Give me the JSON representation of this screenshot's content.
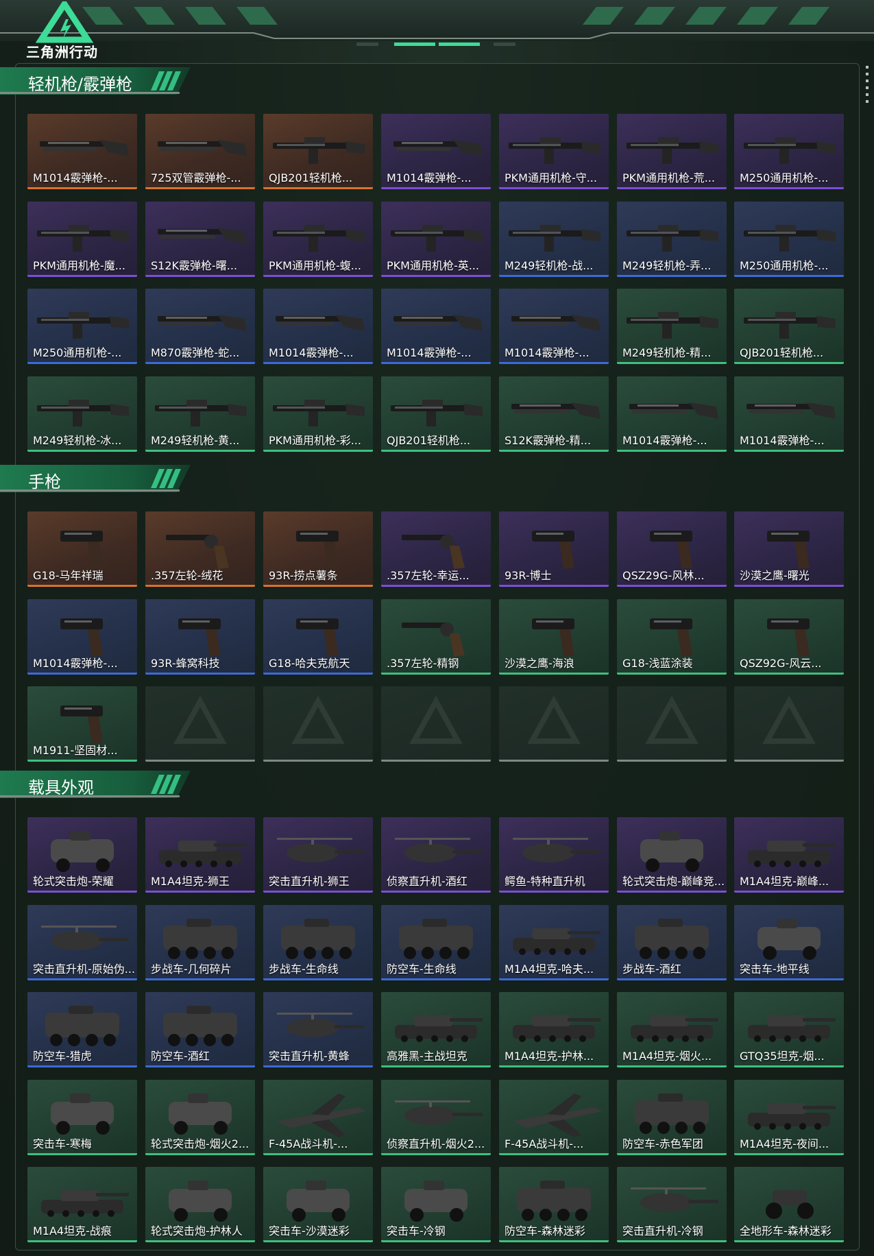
{
  "app": {
    "logo_text": "三角洲行动",
    "accent_color": "#3ddc97"
  },
  "rarity_colors": {
    "orange": "#d9732b",
    "purple": "#7b4fd6",
    "blue": "#3d6ad8",
    "green": "#3fc07e",
    "empty": "#7d8a83"
  },
  "sections": [
    {
      "title": "轻机枪/霰弹枪",
      "items": [
        {
          "label": "M1014霰弹枪-...",
          "rarity": "orange",
          "icon": "shotgun-icon"
        },
        {
          "label": "725双管霰弹枪-...",
          "rarity": "orange",
          "icon": "shotgun-icon"
        },
        {
          "label": "QJB201轻机枪...",
          "rarity": "orange",
          "icon": "machine-gun-icon"
        },
        {
          "label": "M1014霰弹枪-...",
          "rarity": "purple",
          "icon": "shotgun-icon"
        },
        {
          "label": "PKM通用机枪-守...",
          "rarity": "purple",
          "icon": "machine-gun-icon"
        },
        {
          "label": "PKM通用机枪-荒...",
          "rarity": "purple",
          "icon": "machine-gun-icon"
        },
        {
          "label": "M250通用机枪-...",
          "rarity": "purple",
          "icon": "machine-gun-icon"
        },
        {
          "label": "PKM通用机枪-魔...",
          "rarity": "purple",
          "icon": "machine-gun-icon"
        },
        {
          "label": "S12K霰弹枪-曙...",
          "rarity": "purple",
          "icon": "shotgun-icon"
        },
        {
          "label": "PKM通用机枪-蝮...",
          "rarity": "purple",
          "icon": "machine-gun-icon"
        },
        {
          "label": "PKM通用机枪-英...",
          "rarity": "purple",
          "icon": "machine-gun-icon"
        },
        {
          "label": "M249轻机枪-战...",
          "rarity": "blue",
          "icon": "machine-gun-icon"
        },
        {
          "label": "M249轻机枪-弄...",
          "rarity": "blue",
          "icon": "machine-gun-icon"
        },
        {
          "label": "M250通用机枪-...",
          "rarity": "blue",
          "icon": "machine-gun-icon"
        },
        {
          "label": "M250通用机枪-...",
          "rarity": "blue",
          "icon": "machine-gun-icon"
        },
        {
          "label": "M870霰弹枪-蛇...",
          "rarity": "blue",
          "icon": "shotgun-icon"
        },
        {
          "label": "M1014霰弹枪-...",
          "rarity": "blue",
          "icon": "shotgun-icon"
        },
        {
          "label": "M1014霰弹枪-...",
          "rarity": "blue",
          "icon": "shotgun-icon"
        },
        {
          "label": "M1014霰弹枪-...",
          "rarity": "blue",
          "icon": "shotgun-icon"
        },
        {
          "label": "M249轻机枪-精...",
          "rarity": "green",
          "icon": "machine-gun-icon"
        },
        {
          "label": "QJB201轻机枪...",
          "rarity": "green",
          "icon": "machine-gun-icon"
        },
        {
          "label": "M249轻机枪-冰...",
          "rarity": "green",
          "icon": "machine-gun-icon"
        },
        {
          "label": "M249轻机枪-黄...",
          "rarity": "green",
          "icon": "machine-gun-icon"
        },
        {
          "label": "PKM通用机枪-彩...",
          "rarity": "green",
          "icon": "machine-gun-icon"
        },
        {
          "label": "QJB201轻机枪...",
          "rarity": "green",
          "icon": "machine-gun-icon"
        },
        {
          "label": "S12K霰弹枪-精...",
          "rarity": "green",
          "icon": "shotgun-icon"
        },
        {
          "label": "M1014霰弹枪-...",
          "rarity": "green",
          "icon": "shotgun-icon"
        },
        {
          "label": "M1014霰弹枪-...",
          "rarity": "green",
          "icon": "shotgun-icon"
        }
      ]
    },
    {
      "title": "手枪",
      "items": [
        {
          "label": "G18-马年祥瑞",
          "rarity": "orange",
          "icon": "pistol-icon"
        },
        {
          "label": ".357左轮-绒花",
          "rarity": "orange",
          "icon": "revolver-icon"
        },
        {
          "label": "93R-捞点薯条",
          "rarity": "orange",
          "icon": "pistol-icon"
        },
        {
          "label": ".357左轮-幸运...",
          "rarity": "purple",
          "icon": "revolver-icon"
        },
        {
          "label": "93R-博士",
          "rarity": "purple",
          "icon": "pistol-icon"
        },
        {
          "label": "QSZ29G-风林...",
          "rarity": "purple",
          "icon": "pistol-icon"
        },
        {
          "label": "沙漠之鹰-曙光",
          "rarity": "purple",
          "icon": "pistol-icon"
        },
        {
          "label": "M1014霰弹枪-...",
          "rarity": "blue",
          "icon": "pistol-icon"
        },
        {
          "label": "93R-蜂窝科技",
          "rarity": "blue",
          "icon": "pistol-icon"
        },
        {
          "label": "G18-哈夫克航天",
          "rarity": "blue",
          "icon": "pistol-icon"
        },
        {
          "label": ".357左轮-精钢",
          "rarity": "green",
          "icon": "revolver-icon"
        },
        {
          "label": "沙漠之鹰-海浪",
          "rarity": "green",
          "icon": "pistol-icon"
        },
        {
          "label": "G18-浅蓝涂装",
          "rarity": "green",
          "icon": "pistol-icon"
        },
        {
          "label": "QSZ92G-风云...",
          "rarity": "green",
          "icon": "pistol-icon"
        },
        {
          "label": "M1911-坚固材...",
          "rarity": "green",
          "icon": "pistol-icon"
        },
        {
          "label": "",
          "rarity": "empty",
          "icon": "placeholder-logo-icon"
        },
        {
          "label": "",
          "rarity": "empty",
          "icon": "placeholder-logo-icon"
        },
        {
          "label": "",
          "rarity": "empty",
          "icon": "placeholder-logo-icon"
        },
        {
          "label": "",
          "rarity": "empty",
          "icon": "placeholder-logo-icon"
        },
        {
          "label": "",
          "rarity": "empty",
          "icon": "placeholder-logo-icon"
        },
        {
          "label": "",
          "rarity": "empty",
          "icon": "placeholder-logo-icon"
        }
      ]
    },
    {
      "title": "载具外观",
      "items": [
        {
          "label": "轮式突击炮-荣耀",
          "rarity": "purple",
          "icon": "armored-car-icon"
        },
        {
          "label": "M1A4坦克-狮王",
          "rarity": "purple",
          "icon": "tank-icon"
        },
        {
          "label": "突击直升机-狮王",
          "rarity": "purple",
          "icon": "helicopter-icon"
        },
        {
          "label": "侦察直升机-酒红",
          "rarity": "purple",
          "icon": "helicopter-icon"
        },
        {
          "label": "鳄鱼-特种直升机",
          "rarity": "purple",
          "icon": "helicopter-icon"
        },
        {
          "label": "轮式突击炮-巅峰竞...",
          "rarity": "purple",
          "icon": "armored-car-icon"
        },
        {
          "label": "M1A4坦克-巅峰...",
          "rarity": "purple",
          "icon": "tank-icon"
        },
        {
          "label": "突击直升机-原始伪...",
          "rarity": "blue",
          "icon": "helicopter-icon"
        },
        {
          "label": "步战车-几何碎片",
          "rarity": "blue",
          "icon": "apc-icon"
        },
        {
          "label": "步战车-生命线",
          "rarity": "blue",
          "icon": "apc-icon"
        },
        {
          "label": "防空车-生命线",
          "rarity": "blue",
          "icon": "apc-icon"
        },
        {
          "label": "M1A4坦克-哈夫...",
          "rarity": "blue",
          "icon": "tank-icon"
        },
        {
          "label": "步战车-酒红",
          "rarity": "blue",
          "icon": "apc-icon"
        },
        {
          "label": "突击车-地平线",
          "rarity": "blue",
          "icon": "armored-car-icon"
        },
        {
          "label": "防空车-猎虎",
          "rarity": "blue",
          "icon": "apc-icon"
        },
        {
          "label": "防空车-酒红",
          "rarity": "blue",
          "icon": "apc-icon"
        },
        {
          "label": "突击直升机-黄蜂",
          "rarity": "blue",
          "icon": "helicopter-icon"
        },
        {
          "label": "高雅黑-主战坦克",
          "rarity": "green",
          "icon": "tank-icon"
        },
        {
          "label": "M1A4坦克-护林...",
          "rarity": "green",
          "icon": "tank-icon"
        },
        {
          "label": "M1A4坦克-烟火...",
          "rarity": "green",
          "icon": "tank-icon"
        },
        {
          "label": "GTQ35坦克-烟...",
          "rarity": "green",
          "icon": "tank-icon"
        },
        {
          "label": "突击车-寒梅",
          "rarity": "green",
          "icon": "armored-car-icon"
        },
        {
          "label": "轮式突击炮-烟火2...",
          "rarity": "green",
          "icon": "armored-car-icon"
        },
        {
          "label": "F-45A战斗机-...",
          "rarity": "green",
          "icon": "jet-icon"
        },
        {
          "label": "侦察直升机-烟火2...",
          "rarity": "green",
          "icon": "helicopter-icon"
        },
        {
          "label": "F-45A战斗机-...",
          "rarity": "green",
          "icon": "jet-icon"
        },
        {
          "label": "防空车-赤色军团",
          "rarity": "green",
          "icon": "apc-icon"
        },
        {
          "label": "M1A4坦克-夜间...",
          "rarity": "green",
          "icon": "tank-icon"
        },
        {
          "label": "M1A4坦克-战痕",
          "rarity": "green",
          "icon": "tank-icon"
        },
        {
          "label": "轮式突击炮-护林人",
          "rarity": "green",
          "icon": "armored-car-icon"
        },
        {
          "label": "突击车-沙漠迷彩",
          "rarity": "green",
          "icon": "armored-car-icon"
        },
        {
          "label": "突击车-冷钢",
          "rarity": "green",
          "icon": "armored-car-icon"
        },
        {
          "label": "防空车-森林迷彩",
          "rarity": "green",
          "icon": "apc-icon"
        },
        {
          "label": "突击直升机-冷钢",
          "rarity": "green",
          "icon": "helicopter-icon"
        },
        {
          "label": "全地形车-森林迷彩",
          "rarity": "green",
          "icon": "atv-icon"
        }
      ]
    }
  ]
}
